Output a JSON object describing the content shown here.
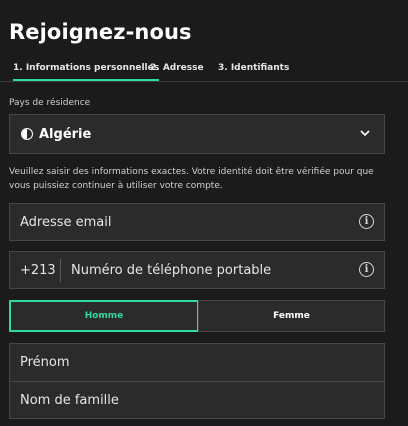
{
  "page": {
    "title": "Rejoignez-nous"
  },
  "tabs": [
    {
      "label": "1. Informations personnelles",
      "active": true
    },
    {
      "label": "2. Adresse",
      "active": false
    },
    {
      "label": "3. Identifiants",
      "active": false
    }
  ],
  "residence": {
    "label": "Pays de résidence",
    "selected": "Algérie",
    "icon": "algeria-flag-icon"
  },
  "help_text": "Veuillez saisir des informations exactes. Votre identité doit être vérifiée pour que vous puissiez continuer à utiliser votre compte.",
  "email": {
    "placeholder": "Adresse email",
    "icon": "info-icon"
  },
  "phone": {
    "prefix": "+213",
    "placeholder": "Numéro de téléphone portable",
    "icon": "info-icon"
  },
  "gender": {
    "options": [
      "Homme",
      "Femme"
    ],
    "selected": "Homme"
  },
  "name": {
    "first_placeholder": "Prénom",
    "last_placeholder": "Nom de famille"
  },
  "colors": {
    "accent": "#2fd9a2",
    "background": "#1b1b1b",
    "field": "#2b2b2b",
    "border": "#474747"
  }
}
